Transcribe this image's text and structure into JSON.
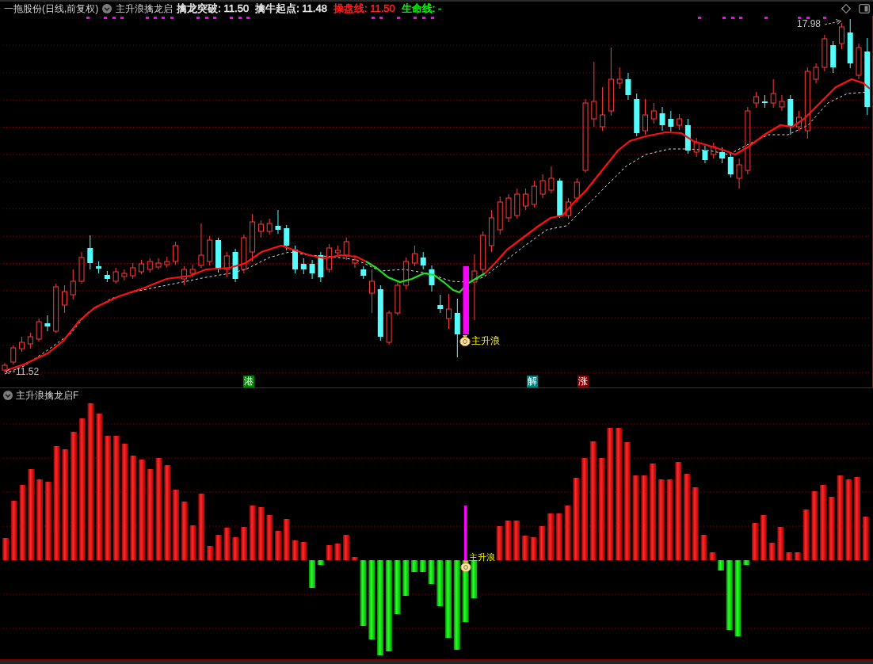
{
  "header": {
    "title": "一拖股份(日线,前复权)",
    "indicator": "主升浪擒龙启",
    "readings": [
      {
        "text": "擒龙突破: 11.50",
        "color": "#e8e8e8"
      },
      {
        "text": "擒牛起点: 11.48",
        "color": "#e8e8e8"
      },
      {
        "text": "操盘线: 11.50",
        "color": "#ff2020"
      },
      {
        "text": "生命线: -",
        "color": "#00ff00"
      }
    ]
  },
  "main_chart": {
    "high_label": "17.98",
    "low_label": "11.52",
    "signal_label": "主升浪",
    "markers": [
      {
        "label": "港",
        "color": "#007f00"
      },
      {
        "label": "解",
        "color": "#008080"
      },
      {
        "label": "涨",
        "color": "#800000"
      }
    ]
  },
  "indicator_panel": {
    "title": "主升浪擒龙启F",
    "signal_label": "主升浪"
  }
}
